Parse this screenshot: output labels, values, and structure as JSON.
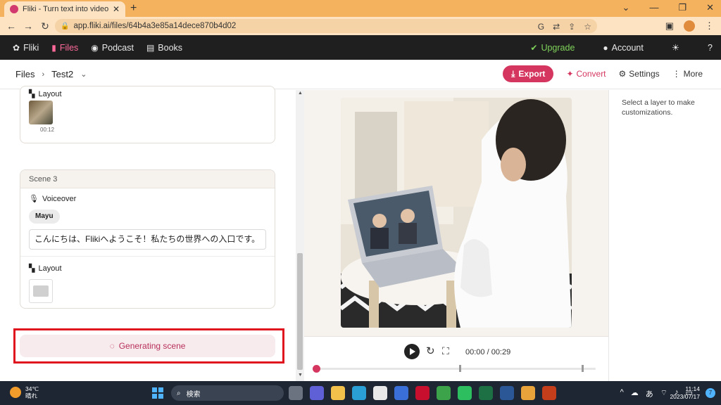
{
  "browser": {
    "tab_title": "Fliki - Turn text into videos with AI",
    "url": "app.fliki.ai/files/64b4a3e85a14dece870b4d02"
  },
  "nav": {
    "brand": "Fliki",
    "files": "Files",
    "podcast": "Podcast",
    "books": "Books",
    "upgrade": "Upgrade",
    "account": "Account"
  },
  "toolbar": {
    "crumb_root": "Files",
    "crumb_current": "Test2",
    "export": "Export",
    "convert": "Convert",
    "settings": "Settings",
    "more": "More"
  },
  "scene_prev": {
    "layout_label": "Layout",
    "thumb_time": "00:12"
  },
  "scene3": {
    "title": "Scene 3",
    "voiceover_label": "Voiceover",
    "voice_name": "Mayu",
    "voice_text": "こんにちは、Flikiへようこそ！私たちの世界への入口です。",
    "layout_label": "Layout"
  },
  "generating": "Generating scene",
  "player": {
    "time": "00:00 / 00:29",
    "progress": 0
  },
  "right_panel": {
    "hint": "Select a layer to make customizations."
  },
  "taskbar": {
    "temp": "34℃",
    "weather": "晴れ",
    "search": "検索",
    "time": "11:14",
    "date": "2023/07/17",
    "ime": "あ"
  },
  "colors": {
    "accent": "#d5365f",
    "upgrade": "#7fd35a",
    "nav_bg": "#1f1f1f",
    "highlight": "#e0141e"
  }
}
